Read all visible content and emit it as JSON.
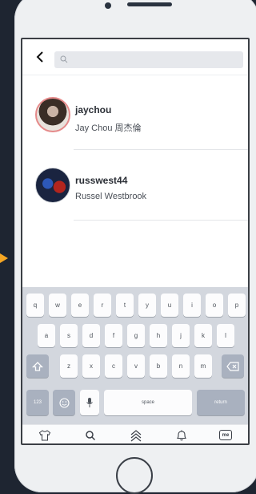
{
  "search": {
    "placeholder": ""
  },
  "results": [
    {
      "username": "jaychou",
      "fullname": "Jay Chou 周杰倫"
    },
    {
      "username": "russwest44",
      "fullname": "Russel Westbrook"
    }
  ],
  "keyboard": {
    "row1": [
      "q",
      "w",
      "e",
      "r",
      "t",
      "y",
      "u",
      "i",
      "o",
      "p"
    ],
    "row2": [
      "a",
      "s",
      "d",
      "f",
      "g",
      "h",
      "j",
      "k",
      "l"
    ],
    "row3": [
      "z",
      "x",
      "c",
      "v",
      "b",
      "n",
      "m"
    ],
    "numbers_label": "123",
    "space_label": "space",
    "return_label": "return"
  },
  "tabbar": {
    "icons": [
      "shirt-icon",
      "search-icon",
      "chevrons-up-icon",
      "bell-icon",
      "me-icon"
    ],
    "me_label": "me"
  },
  "colors": {
    "accent": "#f5a623",
    "keyboard_bg": "#d3d7de",
    "dark_key": "#a9b1bf"
  }
}
